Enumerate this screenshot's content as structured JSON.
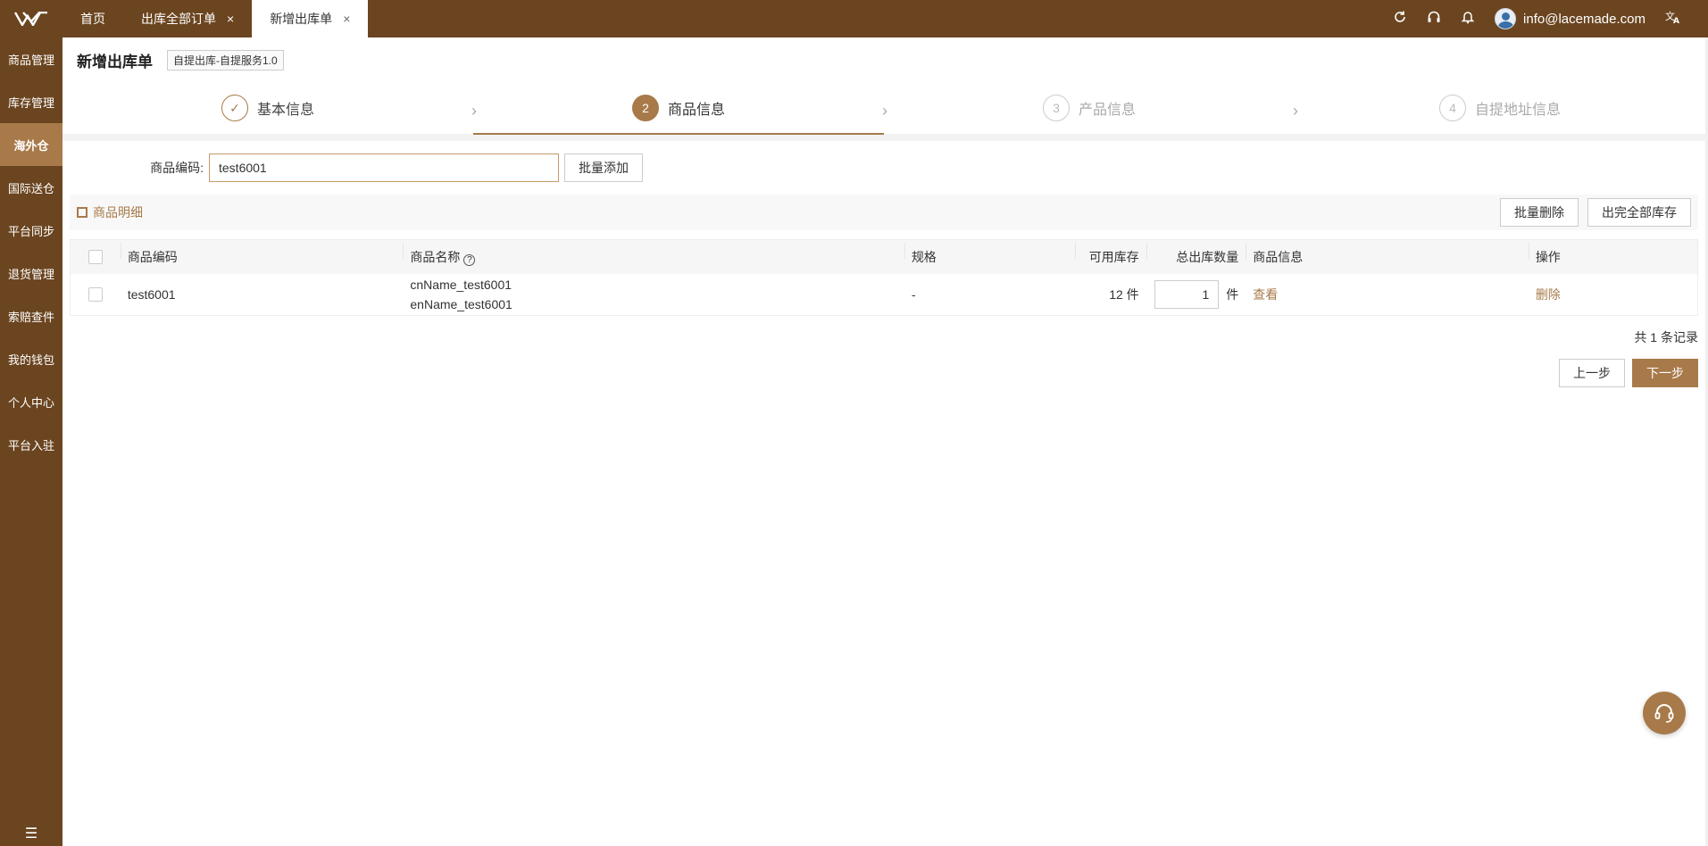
{
  "brand": {
    "logo": "W",
    "accent": "#a87a4a",
    "sidebar_bg": "#6b4520"
  },
  "sidebar": {
    "items": [
      {
        "label": "商品管理"
      },
      {
        "label": "库存管理"
      },
      {
        "label": "海外仓",
        "active": true
      },
      {
        "label": "国际送仓"
      },
      {
        "label": "平台同步"
      },
      {
        "label": "退货管理"
      },
      {
        "label": "索赔查件"
      },
      {
        "label": "我的钱包"
      },
      {
        "label": "个人中心"
      },
      {
        "label": "平台入驻"
      }
    ],
    "toggle_icon": "menu-fold-icon"
  },
  "tabs": [
    {
      "label": "首页"
    },
    {
      "label": "出库全部订单",
      "close": "×"
    },
    {
      "label": "新增出库单",
      "close": "×",
      "active": true
    }
  ],
  "topbar": {
    "user_email": "info@lacemade.com",
    "icons": [
      "refresh-icon",
      "headset-icon",
      "bell-icon",
      "translate-icon"
    ]
  },
  "page": {
    "title": "新增出库单",
    "service_tag": "自提出库-自提服务1.0"
  },
  "steps": [
    {
      "num": "✓",
      "label": "基本信息",
      "state": "done"
    },
    {
      "num": "2",
      "label": "商品信息",
      "state": "current"
    },
    {
      "num": "3",
      "label": "产品信息",
      "state": "todo"
    },
    {
      "num": "4",
      "label": "自提地址信息",
      "state": "todo"
    }
  ],
  "search": {
    "label": "商品编码:",
    "value": "test6001",
    "batch_add": "批量添加"
  },
  "detail": {
    "title": "商品明细",
    "batch_delete": "批量删除",
    "clear_all": "出完全部库存"
  },
  "table": {
    "headers": {
      "code": "商品编码",
      "name": "商品名称",
      "spec": "规格",
      "stock": "可用库存",
      "qty": "总出库数量",
      "info": "商品信息",
      "op": "操作"
    },
    "rows": [
      {
        "code": "test6001",
        "cn_name": "cnName_test6001",
        "en_name": "enName_test6001",
        "spec": "-",
        "stock": "12 件",
        "qty": "1",
        "unit": "件",
        "view": "查看",
        "delete": "删除"
      }
    ]
  },
  "total_text": "共 1 条记录",
  "buttons": {
    "prev": "上一步",
    "next": "下一步"
  }
}
